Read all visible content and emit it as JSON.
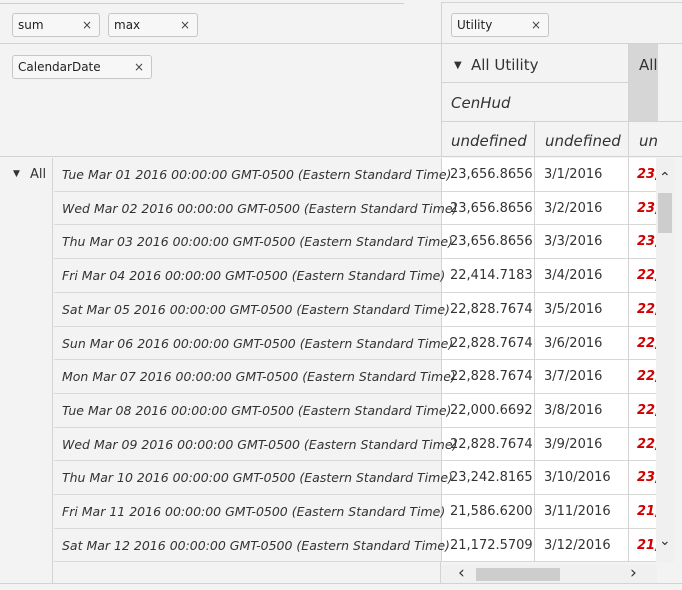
{
  "filters": {
    "value_chips": [
      {
        "label": "sum",
        "close": "×"
      },
      {
        "label": "max",
        "close": "×"
      }
    ],
    "row_chip": {
      "label": "CalendarDate",
      "close": "×"
    },
    "column_chip": {
      "label": "Utility",
      "close": "×"
    }
  },
  "column_header": {
    "level1_arrow": "▼",
    "level1": "All Utility",
    "level1_next": "All",
    "level2": "CenHud",
    "level3": [
      "undefined",
      "undefined",
      "un"
    ]
  },
  "row_header": {
    "all_arrow": "▼",
    "all_label": "All"
  },
  "rows": [
    {
      "date": "Tue Mar 01 2016 00:00:00 GMT-0500 (Eastern Standard Time)",
      "sum": "23,656.8656",
      "max": "3/1/2016",
      "next": "23,"
    },
    {
      "date": "Wed Mar 02 2016 00:00:00 GMT-0500 (Eastern Standard Time)",
      "sum": "23,656.8656",
      "max": "3/2/2016",
      "next": "23,"
    },
    {
      "date": "Thu Mar 03 2016 00:00:00 GMT-0500 (Eastern Standard Time)",
      "sum": "23,656.8656",
      "max": "3/3/2016",
      "next": "23,"
    },
    {
      "date": "Fri Mar 04 2016 00:00:00 GMT-0500 (Eastern Standard Time)",
      "sum": "22,414.7183",
      "max": "3/4/2016",
      "next": "22,"
    },
    {
      "date": "Sat Mar 05 2016 00:00:00 GMT-0500 (Eastern Standard Time)",
      "sum": "22,828.7674",
      "max": "3/5/2016",
      "next": "22,"
    },
    {
      "date": "Sun Mar 06 2016 00:00:00 GMT-0500 (Eastern Standard Time)",
      "sum": "22,828.7674",
      "max": "3/6/2016",
      "next": "22,"
    },
    {
      "date": "Mon Mar 07 2016 00:00:00 GMT-0500 (Eastern Standard Time)",
      "sum": "22,828.7674",
      "max": "3/7/2016",
      "next": "22,"
    },
    {
      "date": "Tue Mar 08 2016 00:00:00 GMT-0500 (Eastern Standard Time)",
      "sum": "22,000.6692",
      "max": "3/8/2016",
      "next": "22,"
    },
    {
      "date": "Wed Mar 09 2016 00:00:00 GMT-0500 (Eastern Standard Time)",
      "sum": "22,828.7674",
      "max": "3/9/2016",
      "next": "22,"
    },
    {
      "date": "Thu Mar 10 2016 00:00:00 GMT-0500 (Eastern Standard Time)",
      "sum": "23,242.8165",
      "max": "3/10/2016",
      "next": "23,"
    },
    {
      "date": "Fri Mar 11 2016 00:00:00 GMT-0500 (Eastern Standard Time)",
      "sum": "21,586.6200",
      "max": "3/11/2016",
      "next": "21,"
    },
    {
      "date": "Sat Mar 12 2016 00:00:00 GMT-0500 (Eastern Standard Time)",
      "sum": "21,172.5709",
      "max": "3/12/2016",
      "next": "21,"
    }
  ],
  "scrollbars": {
    "up": "⌃",
    "down": "⌄",
    "left": "‹",
    "right": "›"
  },
  "colors": {
    "highlight_value": "#d00000",
    "header_selected": "#d6d6d6"
  }
}
